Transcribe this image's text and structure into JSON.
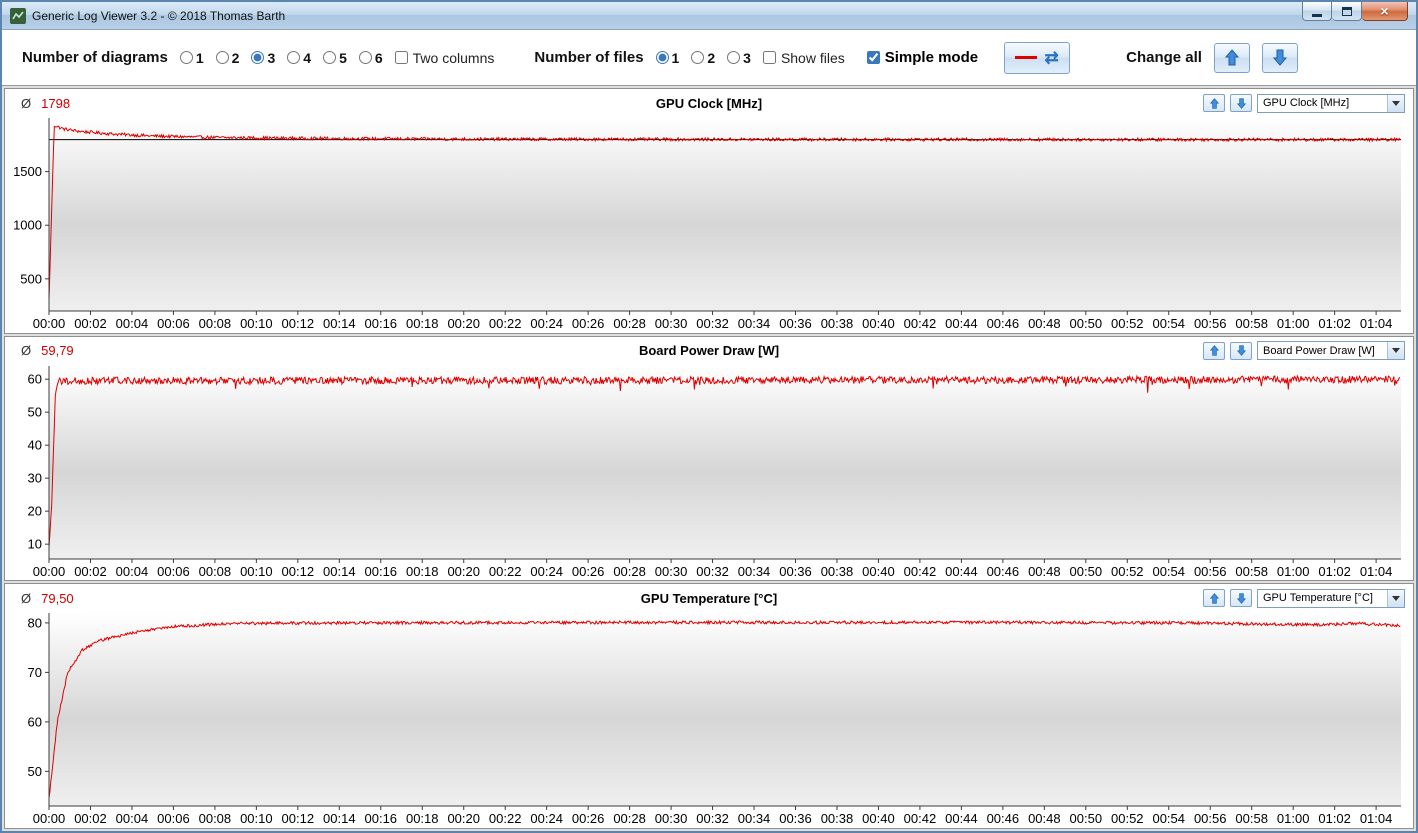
{
  "window": {
    "title": "Generic Log Viewer 3.2 - © 2018 Thomas Barth"
  },
  "toolbar": {
    "diagrams_label": "Number of diagrams",
    "diagram_options": [
      "1",
      "2",
      "3",
      "4",
      "5",
      "6"
    ],
    "diagrams_selected": "3",
    "two_columns_label": "Two columns",
    "two_columns_checked": false,
    "files_label": "Number of files",
    "file_options": [
      "1",
      "2",
      "3"
    ],
    "files_selected": "1",
    "show_files_label": "Show files",
    "show_files_checked": false,
    "simple_mode_label": "Simple mode",
    "simple_mode_checked": true,
    "change_all_label": "Change all"
  },
  "chart_data": [
    {
      "type": "line",
      "title": "GPU Clock [MHz]",
      "avg_prefix": "Ø",
      "avg_label": "1798",
      "avg_value": 1798,
      "dropdown_value": "GPU Clock [MHz]",
      "x_minutes_max": 65.2,
      "x_tick_step_min": 2,
      "x_tick_labels": [
        "00:00",
        "00:02",
        "00:04",
        "00:06",
        "00:08",
        "00:10",
        "00:12",
        "00:14",
        "00:16",
        "00:18",
        "00:20",
        "00:22",
        "00:24",
        "00:26",
        "00:28",
        "00:30",
        "00:32",
        "00:34",
        "00:36",
        "00:38",
        "00:40",
        "00:42",
        "00:44",
        "00:46",
        "00:48",
        "00:50",
        "00:52",
        "00:54",
        "00:56",
        "00:58",
        "01:00",
        "01:02",
        "01:04"
      ],
      "ylim": [
        200,
        2000
      ],
      "yticks": [
        500,
        1000,
        1500
      ],
      "avg_line": {
        "value": 1798,
        "color": "#000000"
      },
      "series": [
        {
          "name": "GPU Clock",
          "color": "#dd0000",
          "noise_amp": 14,
          "keypoints": [
            [
              0,
              300
            ],
            [
              0.25,
              1930
            ],
            [
              0.7,
              1898
            ],
            [
              1.5,
              1875
            ],
            [
              3,
              1852
            ],
            [
              5,
              1832
            ],
            [
              8,
              1818
            ],
            [
              12,
              1810
            ],
            [
              20,
              1803
            ],
            [
              35,
              1800
            ],
            [
              65.2,
              1798
            ]
          ]
        }
      ]
    },
    {
      "type": "line",
      "title": "Board Power Draw [W]",
      "avg_prefix": "Ø",
      "avg_label": "59,79",
      "avg_value": 59.79,
      "dropdown_value": "Board Power Draw [W]",
      "x_minutes_max": 65.2,
      "x_tick_step_min": 2,
      "x_tick_labels": [
        "00:00",
        "00:02",
        "00:04",
        "00:06",
        "00:08",
        "00:10",
        "00:12",
        "00:14",
        "00:16",
        "00:18",
        "00:20",
        "00:22",
        "00:24",
        "00:26",
        "00:28",
        "00:30",
        "00:32",
        "00:34",
        "00:36",
        "00:38",
        "00:40",
        "00:42",
        "00:44",
        "00:46",
        "00:48",
        "00:50",
        "00:52",
        "00:54",
        "00:56",
        "00:58",
        "01:00",
        "01:02",
        "01:04"
      ],
      "ylim": [
        5.5,
        64
      ],
      "yticks": [
        10,
        20,
        30,
        40,
        50,
        60
      ],
      "series": [
        {
          "name": "Board Power Draw",
          "color": "#dd0000",
          "noise_amp": 1.1,
          "dip_chance": 0.013,
          "dip_depth": 3.5,
          "keypoints": [
            [
              0,
              8.5
            ],
            [
              0.12,
              20
            ],
            [
              0.3,
              55
            ],
            [
              0.5,
              59.5
            ],
            [
              65.2,
              59.9
            ]
          ]
        }
      ]
    },
    {
      "type": "line",
      "title": "GPU Temperature [°C]",
      "avg_prefix": "Ø",
      "avg_label": "79,50",
      "avg_value": 79.5,
      "dropdown_value": "GPU Temperature [°C]",
      "x_minutes_max": 65.2,
      "x_tick_step_min": 2,
      "x_tick_labels": [
        "00:00",
        "00:02",
        "00:04",
        "00:06",
        "00:08",
        "00:10",
        "00:12",
        "00:14",
        "00:16",
        "00:18",
        "00:20",
        "00:22",
        "00:24",
        "00:26",
        "00:28",
        "00:30",
        "00:32",
        "00:34",
        "00:36",
        "00:38",
        "00:40",
        "00:42",
        "00:44",
        "00:46",
        "00:48",
        "00:50",
        "00:52",
        "00:54",
        "00:56",
        "00:58",
        "01:00",
        "01:02",
        "01:04"
      ],
      "ylim": [
        43,
        82
      ],
      "yticks": [
        50,
        60,
        70,
        80
      ],
      "series": [
        {
          "name": "GPU Temperature",
          "color": "#dd0000",
          "noise_amp": 0.3,
          "keypoints": [
            [
              0,
              44.5
            ],
            [
              0.4,
              60
            ],
            [
              0.9,
              70
            ],
            [
              1.6,
              74.5
            ],
            [
              2.5,
              76.5
            ],
            [
              4,
              78
            ],
            [
              6,
              79.3
            ],
            [
              9,
              79.9
            ],
            [
              15,
              80
            ],
            [
              30,
              80.1
            ],
            [
              45,
              80.1
            ],
            [
              55,
              80
            ],
            [
              61,
              79.6
            ],
            [
              63,
              79.9
            ],
            [
              65.2,
              79.4
            ]
          ]
        }
      ]
    }
  ]
}
